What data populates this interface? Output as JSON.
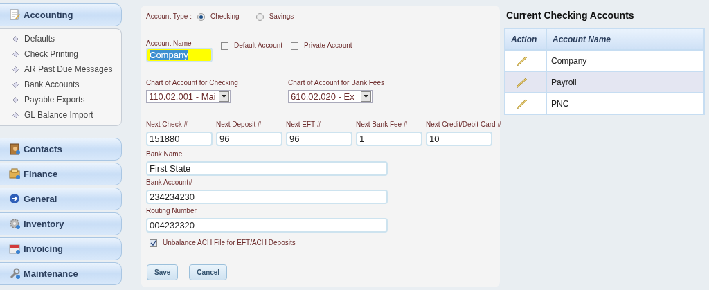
{
  "sidebar": {
    "sections": [
      {
        "label": "Accounting",
        "children": [
          {
            "label": "Defaults"
          },
          {
            "label": "Check Printing"
          },
          {
            "label": "AR Past Due Messages"
          },
          {
            "label": "Bank Accounts"
          },
          {
            "label": "Payable Exports"
          },
          {
            "label": "GL Balance Import"
          }
        ]
      },
      {
        "label": "Contacts"
      },
      {
        "label": "Finance"
      },
      {
        "label": "General"
      },
      {
        "label": "Inventory"
      },
      {
        "label": "Invoicing"
      },
      {
        "label": "Maintenance"
      }
    ]
  },
  "form": {
    "account_type": {
      "label": "Account Type :",
      "options": [
        {
          "label": "Checking",
          "selected": true
        },
        {
          "label": "Savings",
          "selected": false
        }
      ]
    },
    "account_name": {
      "label": "Account Name",
      "value": "Company",
      "text_selected": true
    },
    "flags": [
      {
        "label": "Default Account",
        "checked": false
      },
      {
        "label": "Private Account",
        "checked": false
      }
    ],
    "charts": [
      {
        "label": "Chart of Account for Checking",
        "value": "110.02.001 - Mai"
      },
      {
        "label": "Chart of Account for Bank Fees",
        "value": "610.02.020 - Ex"
      }
    ],
    "numbers": [
      {
        "label": "Next Check #",
        "value": "151880"
      },
      {
        "label": "Next Deposit #",
        "value": "96"
      },
      {
        "label": "Next EFT #",
        "value": "96"
      },
      {
        "label": "Next Bank Fee #",
        "value": "1"
      },
      {
        "label": "Next Credit/Debit Card #",
        "value": "10"
      }
    ],
    "bank_fields": [
      {
        "label": "Bank Name",
        "value": "First State"
      },
      {
        "label": "Bank Account#",
        "value": "234234230"
      },
      {
        "label": "Routing Number",
        "value": "004232320"
      }
    ],
    "unbalance": {
      "label": "Unbalance ACH File for EFT/ACH Deposits",
      "checked": true
    },
    "buttons": [
      "Save",
      "Cancel"
    ]
  },
  "accounts": {
    "title": "Current Checking Accounts",
    "columns": [
      "Action",
      "Account Name"
    ],
    "rows": [
      {
        "name": "Company",
        "selected": false
      },
      {
        "name": "Payroll",
        "selected": true
      },
      {
        "name": "PNC",
        "selected": false
      }
    ]
  }
}
